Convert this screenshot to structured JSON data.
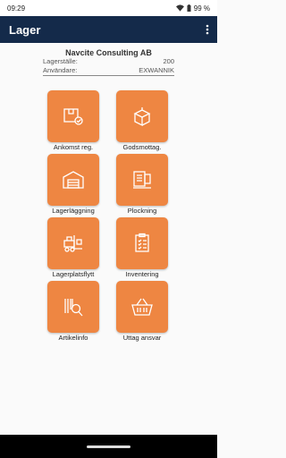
{
  "status": {
    "time": "09:29",
    "battery": "99 %"
  },
  "app": {
    "title": "Lager"
  },
  "info": {
    "company": "Navcite Consulting AB",
    "location_label": "Lagerställe:",
    "location_value": "200",
    "user_label": "Användare:",
    "user_value": "EXWANNIK"
  },
  "tiles": [
    {
      "label": "Ankomst reg.",
      "icon": "package-check-icon"
    },
    {
      "label": "Godsmottag.",
      "icon": "open-box-icon"
    },
    {
      "label": "Lagerläggning",
      "icon": "warehouse-icon"
    },
    {
      "label": "Plockning",
      "icon": "pallet-icon"
    },
    {
      "label": "Lagerplatsflytt",
      "icon": "forklift-icon"
    },
    {
      "label": "Inventering",
      "icon": "clipboard-icon"
    },
    {
      "label": "Artikelinfo",
      "icon": "barcode-search-icon"
    },
    {
      "label": "Uttag ansvar",
      "icon": "basket-icon"
    }
  ],
  "colors": {
    "appbar": "#142a4a",
    "tile": "#ee8642"
  }
}
